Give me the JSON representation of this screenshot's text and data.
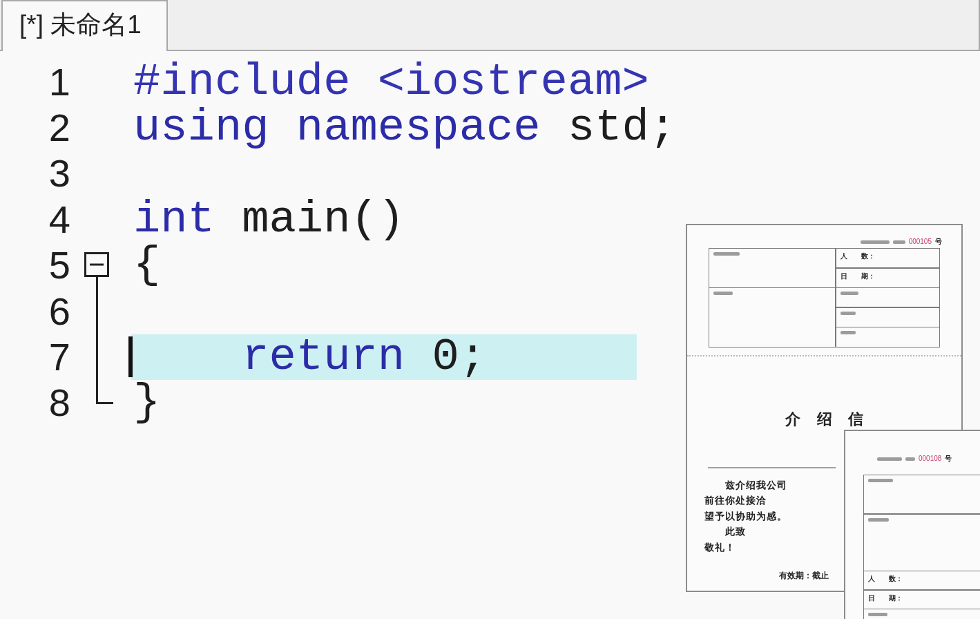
{
  "tabs": [
    {
      "label": "[*] 未命名1",
      "selected": true
    }
  ],
  "editor": {
    "lines": [
      {
        "number": "1",
        "current": false,
        "tokens": [
          {
            "text": "#include <iostream>",
            "kind": "preprocessor"
          }
        ]
      },
      {
        "number": "2",
        "current": false,
        "tokens": [
          {
            "text": "using namespace",
            "kind": "keyword"
          },
          {
            "text": " std;",
            "kind": "plain"
          }
        ]
      },
      {
        "number": "3",
        "current": false
      },
      {
        "number": "4",
        "current": false,
        "tokens": [
          {
            "text": "int",
            "kind": "keyword"
          },
          {
            "text": " main()",
            "kind": "plain"
          }
        ]
      },
      {
        "number": "5",
        "current": false,
        "expanded": true,
        "tokens": [
          {
            "text": "{",
            "kind": "plain"
          }
        ],
        "children": [
          {
            "number": "6",
            "current": false
          },
          {
            "number": "7",
            "current": true,
            "tokens": [
              {
                "text": "    return",
                "kind": "keyword"
              },
              {
                "text": " 0;",
                "kind": "plain"
              }
            ]
          },
          {
            "number": "8",
            "current": false,
            "tokens": [
              {
                "text": "}",
                "kind": "plain"
              }
            ]
          }
        ]
      }
    ]
  },
  "document_previews": [
    {
      "kind": "letter",
      "serial": "000105",
      "serial_unit": "号",
      "form_fields": [
        {
          "label": "人　　数："
        },
        {
          "label": "日　　期："
        }
      ],
      "title": "介 绍 信",
      "letter_lines": [
        "　　兹介绍我公司",
        "前往你处接洽",
        "望予以协助为感。",
        "　　此致",
        "敬礼！"
      ],
      "validity": "有效期：截止"
    },
    {
      "kind": "form-stub",
      "serial": "000108",
      "serial_unit": "号",
      "form_fields": [
        {
          "label": "人　　数："
        },
        {
          "label": "日　　期："
        }
      ]
    }
  ]
}
